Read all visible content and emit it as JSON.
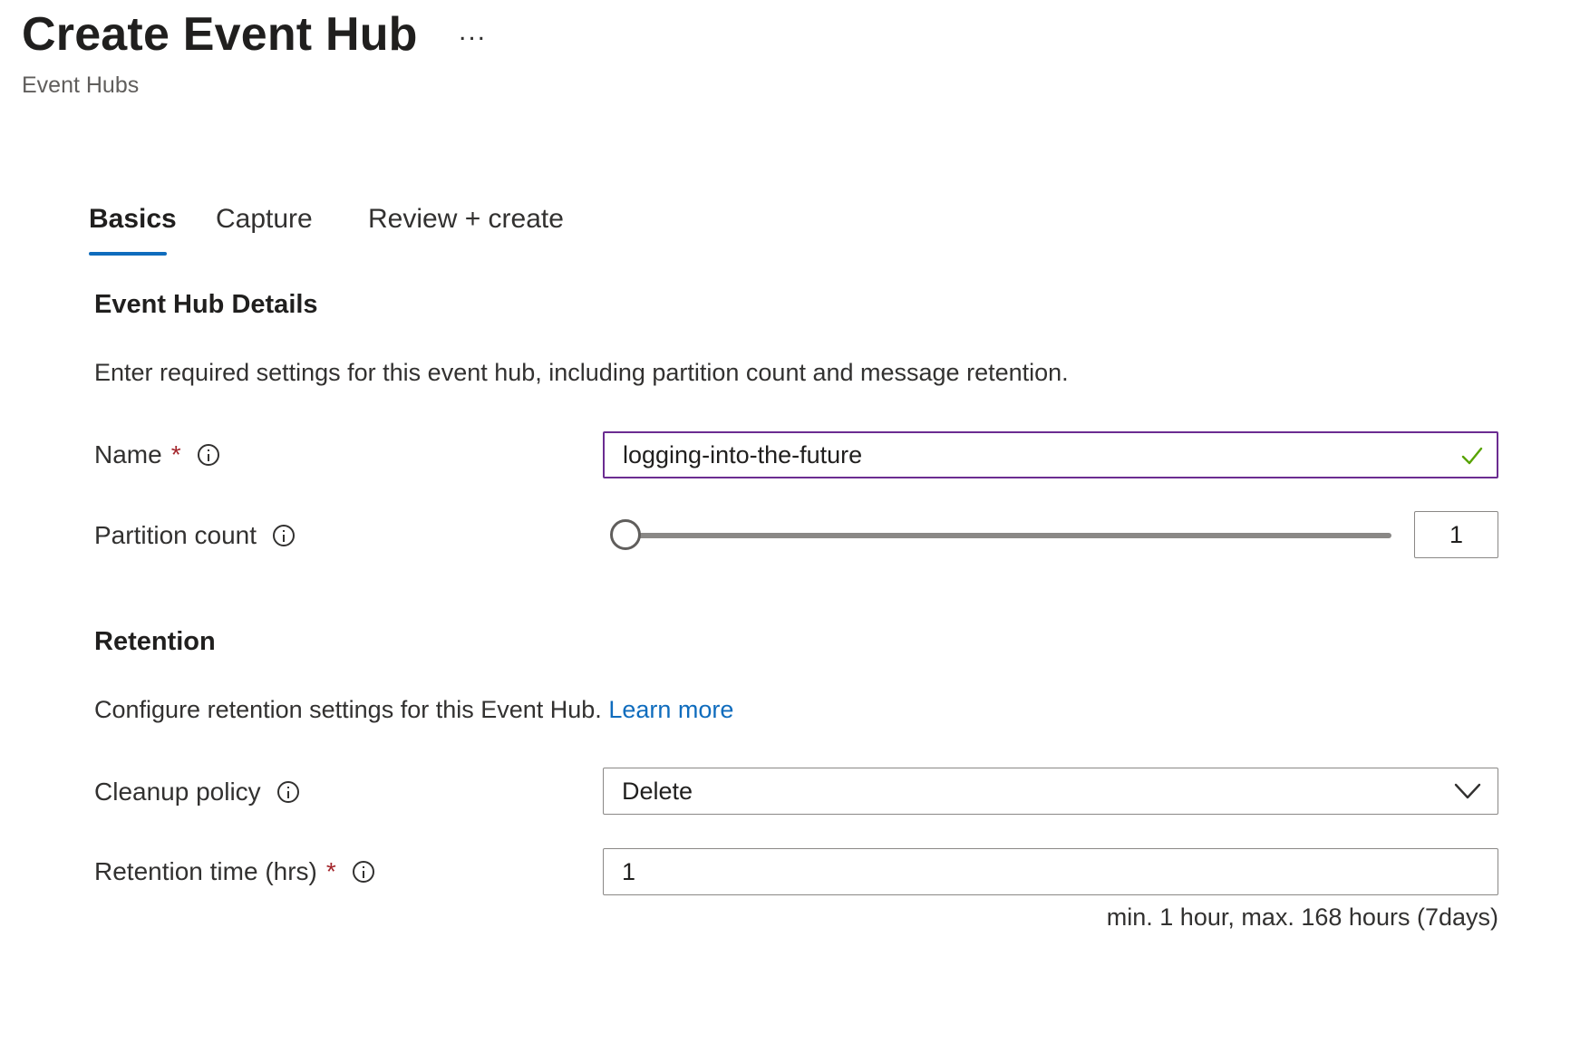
{
  "header": {
    "title": "Create Event Hub",
    "more_label": "...",
    "subtitle": "Event Hubs"
  },
  "tabs": [
    {
      "label": "Basics",
      "active": true
    },
    {
      "label": "Capture",
      "active": false
    },
    {
      "label": "Review + create",
      "active": false
    }
  ],
  "details": {
    "title": "Event Hub Details",
    "description": "Enter required settings for this event hub, including partition count and message retention.",
    "name": {
      "label": "Name",
      "required_mark": "*",
      "value": "logging-into-the-future",
      "icon": "info-icon",
      "status_icon": "check-icon"
    },
    "partition_count": {
      "label": "Partition count",
      "value": "1",
      "slider_fraction": 0,
      "icon": "info-icon"
    }
  },
  "retention": {
    "title": "Retention",
    "description": "Configure retention settings for this Event Hub.",
    "learn_more": "Learn more",
    "cleanup_policy": {
      "label": "Cleanup policy",
      "value": "Delete",
      "icon": "info-icon"
    },
    "retention_time": {
      "label": "Retention time (hrs)",
      "required_mark": "*",
      "value": "1",
      "hint": "min. 1 hour, max. 168 hours (7days)",
      "icon": "info-icon"
    }
  },
  "colors": {
    "accent": "#0f6cbd",
    "valid_border": "#6b2c91",
    "success": "#57a300",
    "required": "#a4262c"
  }
}
